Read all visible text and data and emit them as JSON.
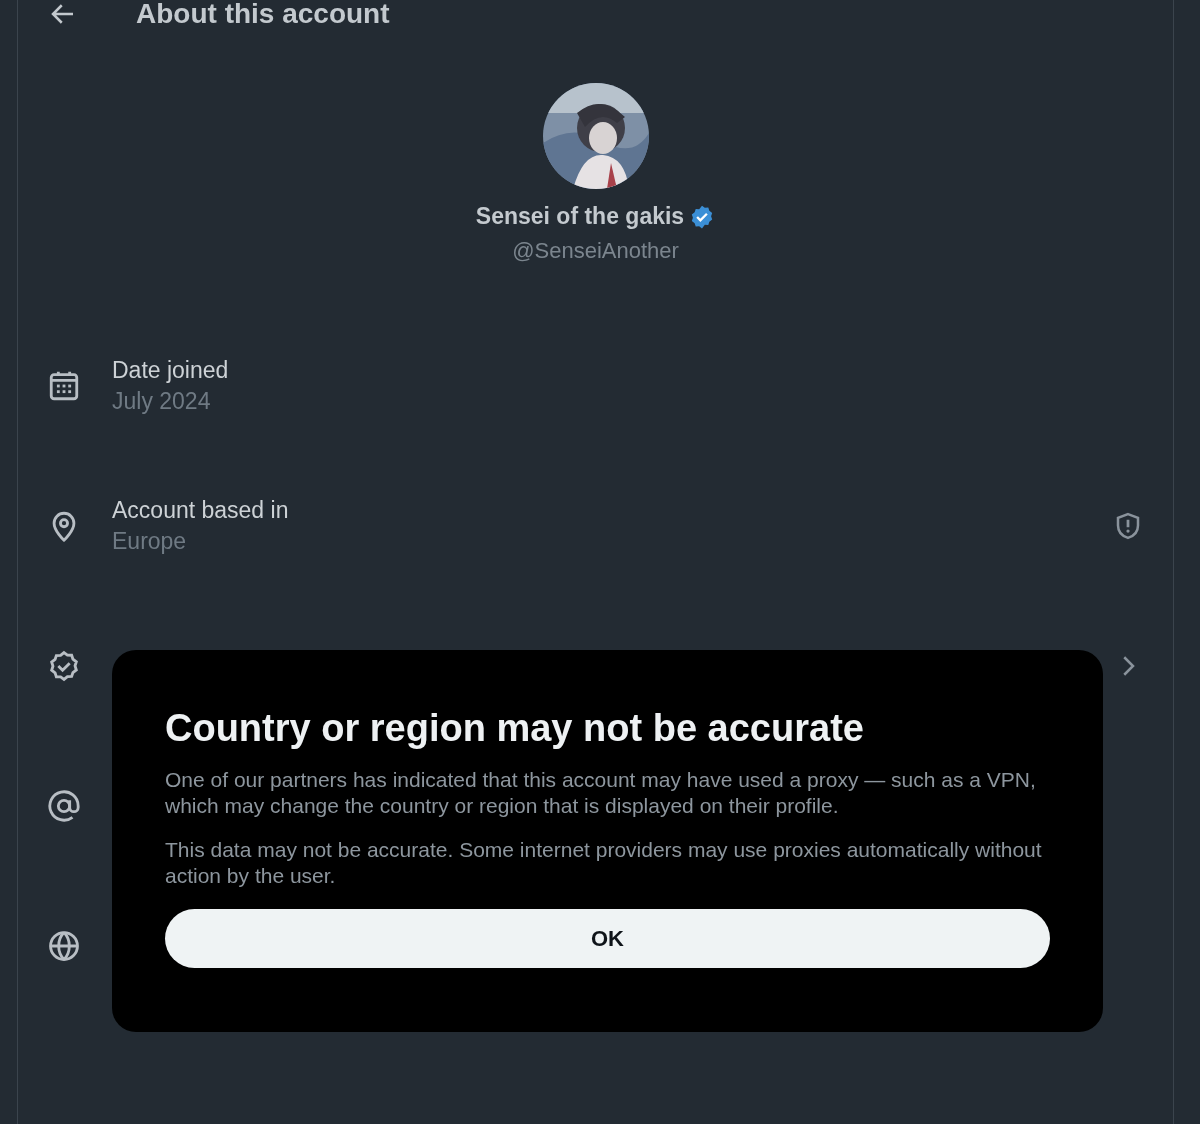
{
  "header": {
    "title": "About this account"
  },
  "profile": {
    "name": "Sensei of the gakis",
    "verified": true,
    "handle": "@SenseiAnother"
  },
  "rows": [
    {
      "kind": "plain",
      "label": "Date joined",
      "value": "July 2024"
    },
    {
      "kind": "flagged",
      "label": "Account based in",
      "value": "Europe"
    },
    {
      "kind": "link"
    },
    {
      "kind": "plain"
    },
    {
      "kind": "plain"
    }
  ],
  "dialog": {
    "title": "Country or region may not be accurate",
    "paragraphs": [
      "One of our partners has indicated that this account may have used a proxy — such as a VPN, which may change the country or region that is displayed on their profile.",
      "This data may not be accurate. Some internet providers may use proxies automatically without action by the user."
    ],
    "button": "OK"
  }
}
